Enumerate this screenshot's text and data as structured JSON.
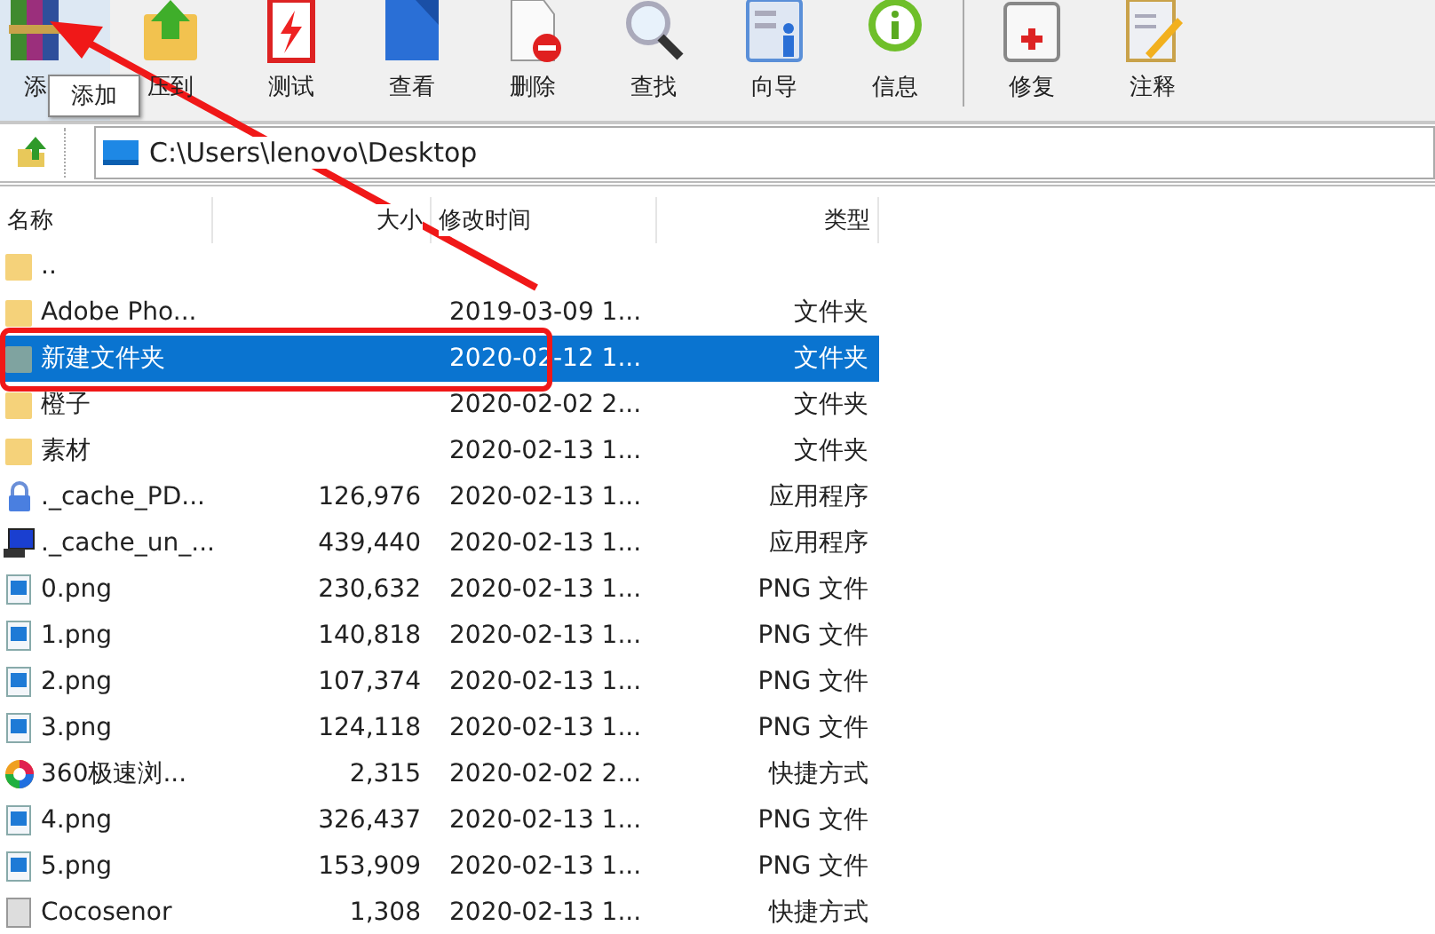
{
  "toolbar": {
    "buttons": [
      {
        "label": "添"
      },
      {
        "label": "压到"
      },
      {
        "label": "测试"
      },
      {
        "label": "查看"
      },
      {
        "label": "删除"
      },
      {
        "label": "查找"
      },
      {
        "label": "向导"
      },
      {
        "label": "信息"
      },
      {
        "label": "修复"
      },
      {
        "label": "注释"
      }
    ]
  },
  "tooltip": "添加",
  "address": "C:\\Users\\lenovo\\Desktop",
  "table": {
    "columns": [
      "名称",
      "大小",
      "修改时间",
      "类型"
    ],
    "rows": [
      {
        "name": "..",
        "kind": "folder",
        "selected": false
      },
      {
        "name": "Adobe Pho...",
        "modified": "2019-03-09 1...",
        "type": "文件夹",
        "kind": "folder",
        "selected": false
      },
      {
        "name": "新建文件夹",
        "modified": "2020-02-12 1...",
        "type": "文件夹",
        "kind": "folder",
        "selected": true
      },
      {
        "name": "橙子",
        "modified": "2020-02-02 2...",
        "type": "文件夹",
        "kind": "folder",
        "selected": false
      },
      {
        "name": "素材",
        "modified": "2020-02-13 1...",
        "type": "文件夹",
        "kind": "folder",
        "selected": false
      },
      {
        "name": "._cache_PD...",
        "size": "126,976",
        "modified": "2020-02-13 1...",
        "type": "应用程序",
        "kind": "application",
        "selected": false
      },
      {
        "name": "._cache_un_...",
        "size": "439,440",
        "modified": "2020-02-13 1...",
        "type": "应用程序",
        "kind": "application",
        "selected": false
      },
      {
        "name": "0.png",
        "size": "230,632",
        "modified": "2020-02-13 1...",
        "type": "PNG 文件",
        "kind": "image",
        "selected": false
      },
      {
        "name": "1.png",
        "size": "140,818",
        "modified": "2020-02-13 1...",
        "type": "PNG 文件",
        "kind": "image",
        "selected": false
      },
      {
        "name": "2.png",
        "size": "107,374",
        "modified": "2020-02-13 1...",
        "type": "PNG 文件",
        "kind": "image",
        "selected": false
      },
      {
        "name": "3.png",
        "size": "124,118",
        "modified": "2020-02-13 1...",
        "type": "PNG 文件",
        "kind": "image",
        "selected": false
      },
      {
        "name": "360极速浏...",
        "size": "2,315",
        "modified": "2020-02-02 2...",
        "type": "快捷方式",
        "kind": "shortcut",
        "selected": false
      },
      {
        "name": "4.png",
        "size": "326,437",
        "modified": "2020-02-13 1...",
        "type": "PNG 文件",
        "kind": "image",
        "selected": false
      },
      {
        "name": "5.png",
        "size": "153,909",
        "modified": "2020-02-13 1...",
        "type": "PNG 文件",
        "kind": "image",
        "selected": false
      },
      {
        "name": "Cocosenor",
        "size": "1,308",
        "modified": "2020-02-13 1...",
        "type": "快捷方式",
        "kind": "shortcut",
        "selected": false
      }
    ]
  }
}
